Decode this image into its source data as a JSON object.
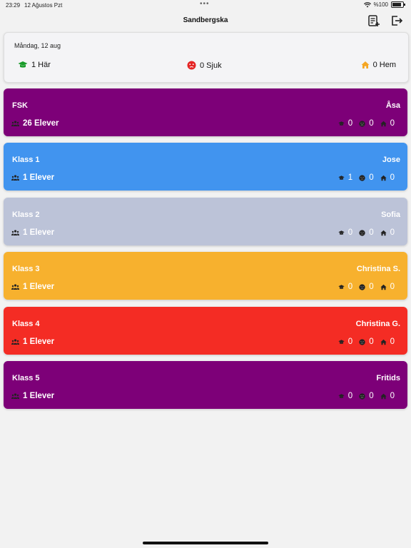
{
  "status": {
    "time": "23:29",
    "date": "12 Ağustos Pzt",
    "battery": "%100"
  },
  "nav": {
    "title": "Sandbergska"
  },
  "summary": {
    "date": "Måndag, 12 aug",
    "here": "1 Här",
    "sick": "0 Sjuk",
    "home": "0 Hem"
  },
  "classes": [
    {
      "name": "FSK",
      "teacher": "Åsa",
      "students": "26 Elever",
      "here": "0",
      "sick": "0",
      "home": "0",
      "color": "#7d0078"
    },
    {
      "name": "Klass 1",
      "teacher": "Jose",
      "students": "1 Elever",
      "here": "1",
      "sick": "0",
      "home": "0",
      "color": "#4194ef"
    },
    {
      "name": "Klass 2",
      "teacher": "Sofia",
      "students": "1 Elever",
      "here": "0",
      "sick": "0",
      "home": "0",
      "color": "#bcc3d8"
    },
    {
      "name": "Klass 3",
      "teacher": "Christina S.",
      "students": "1 Elever",
      "here": "0",
      "sick": "0",
      "home": "0",
      "color": "#f7b12e"
    },
    {
      "name": "Klass 4",
      "teacher": "Christina G.",
      "students": "1 Elever",
      "here": "0",
      "sick": "0",
      "home": "0",
      "color": "#f42c24"
    },
    {
      "name": "Klass 5",
      "teacher": "Fritids",
      "students": "1 Elever",
      "here": "0",
      "sick": "0",
      "home": "0",
      "color": "#7d0078"
    }
  ],
  "colors": {
    "here_icon": "#1a9c2a",
    "sick_icon": "#e42525",
    "home_icon": "#f5a623"
  }
}
